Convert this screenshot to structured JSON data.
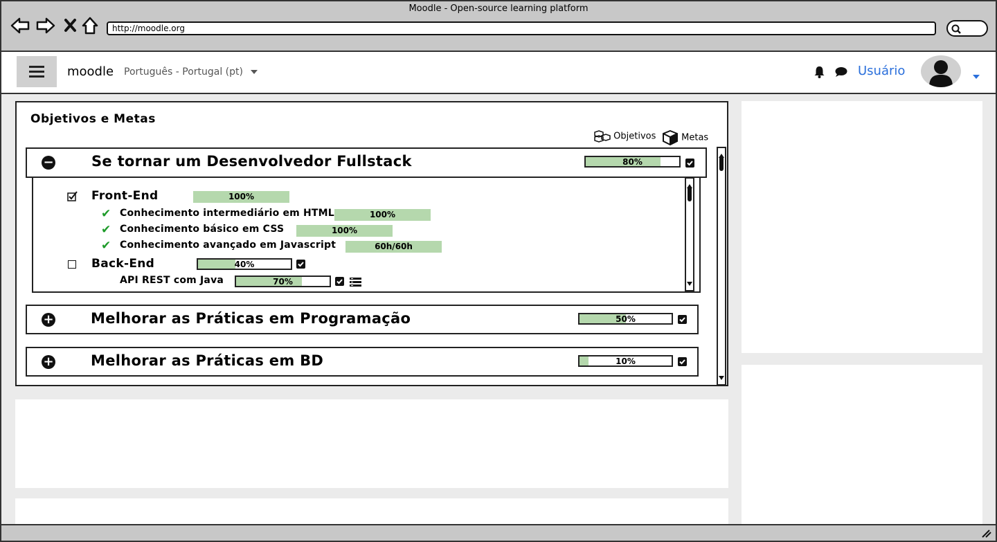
{
  "browser": {
    "window_title": "Moodle - Open-source learning platform",
    "url": "http://moodle.org"
  },
  "header": {
    "brand": "moodle",
    "language": "Português - Portugal (pt)",
    "user_label": "Usuário"
  },
  "panel": {
    "title": "Objetivos e Metas",
    "legend_objectives": "Objetivos",
    "legend_goals": "Metas",
    "goals": [
      {
        "title": "Se tornar um Desenvolvedor Fullstack",
        "progress_label": "80%",
        "progress": 0.8,
        "expanded": true,
        "sections": [
          {
            "title": "Front-End",
            "progress_label": "100%",
            "checked": true,
            "items": [
              {
                "label": "Conhecimento intermediário em HTML",
                "progress_label": "100%"
              },
              {
                "label": "Conhecimento básico em CSS",
                "progress_label": "100%"
              },
              {
                "label": "Conhecimento avançado em Javascript",
                "progress_label": "60h/60h"
              }
            ]
          },
          {
            "title": "Back-End",
            "progress_label": "40%",
            "progress": 0.4,
            "checked": false,
            "items": [
              {
                "label": "API REST com Java",
                "progress_label": "70%",
                "progress": 0.7
              }
            ]
          }
        ]
      },
      {
        "title": "Melhorar as Práticas em Programação",
        "progress_label": "50%",
        "progress": 0.5,
        "expanded": false
      },
      {
        "title": "Melhorar as Práticas em BD",
        "progress_label": "10%",
        "progress": 0.1,
        "expanded": false
      }
    ]
  },
  "colors": {
    "progress_fill": "#b5d8ad",
    "link": "#2a6fdb",
    "check_green": "#1e9b2a"
  }
}
